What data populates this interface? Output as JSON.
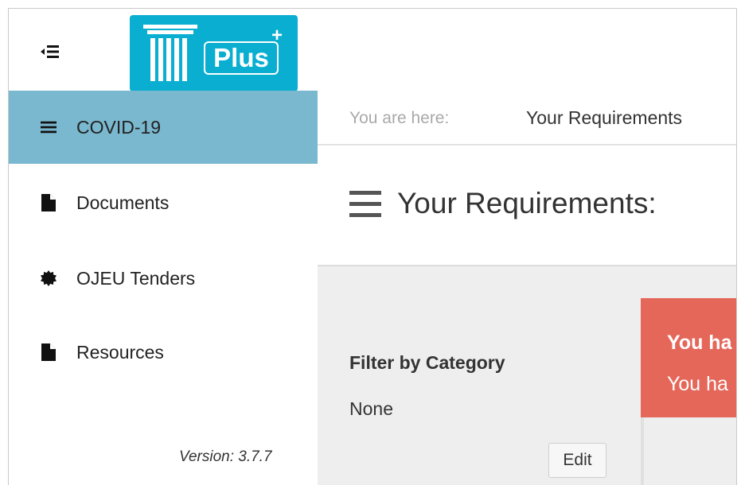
{
  "logo": {
    "text": "Plus",
    "badge": "+"
  },
  "sidebar": {
    "items": [
      {
        "label": "COVID-19",
        "icon": "bars-icon",
        "active": true
      },
      {
        "label": "Documents",
        "icon": "file-icon",
        "active": false
      },
      {
        "label": "OJEU Tenders",
        "icon": "badge-icon",
        "active": false
      },
      {
        "label": "Resources",
        "icon": "file-icon",
        "active": false
      }
    ],
    "version": "Version: 3.7.7"
  },
  "breadcrumb": {
    "prefix": "You are here:",
    "current": "Your Requirements"
  },
  "page": {
    "title": "Your Requirements:"
  },
  "filter": {
    "title": "Filter by Category",
    "value": "None",
    "edit_label": "Edit"
  },
  "alert": {
    "title": "You ha",
    "body": "You ha"
  },
  "colors": {
    "accent": "#0aaed0",
    "sidebar_active": "#7ab8cf",
    "alert": "#e5675a",
    "content_bg": "#eeeeee"
  }
}
